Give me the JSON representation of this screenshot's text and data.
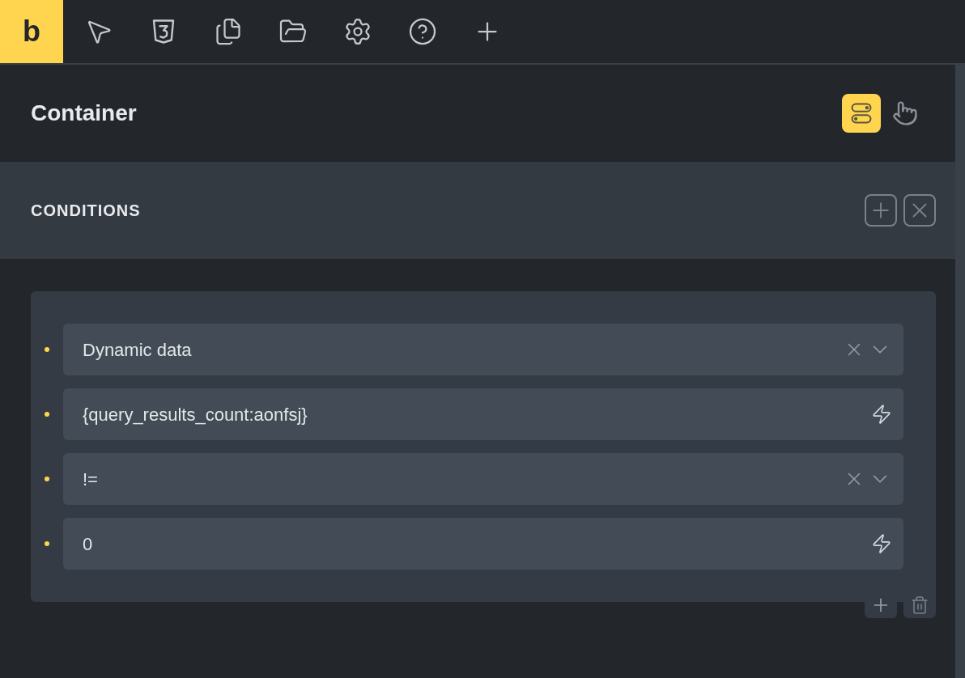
{
  "logo": "b",
  "panel": {
    "title": "Container",
    "modes": [
      {
        "kind": "conditions",
        "selected": true
      },
      {
        "kind": "interactions",
        "selected": false
      }
    ]
  },
  "conditions": {
    "heading": "CONDITIONS",
    "fields": [
      {
        "kind": "select",
        "value": "Dynamic data"
      },
      {
        "kind": "dynamic",
        "value": "{query_results_count:aonfsj}"
      },
      {
        "kind": "select",
        "value": "!="
      },
      {
        "kind": "dynamic",
        "value": "0"
      }
    ]
  }
}
